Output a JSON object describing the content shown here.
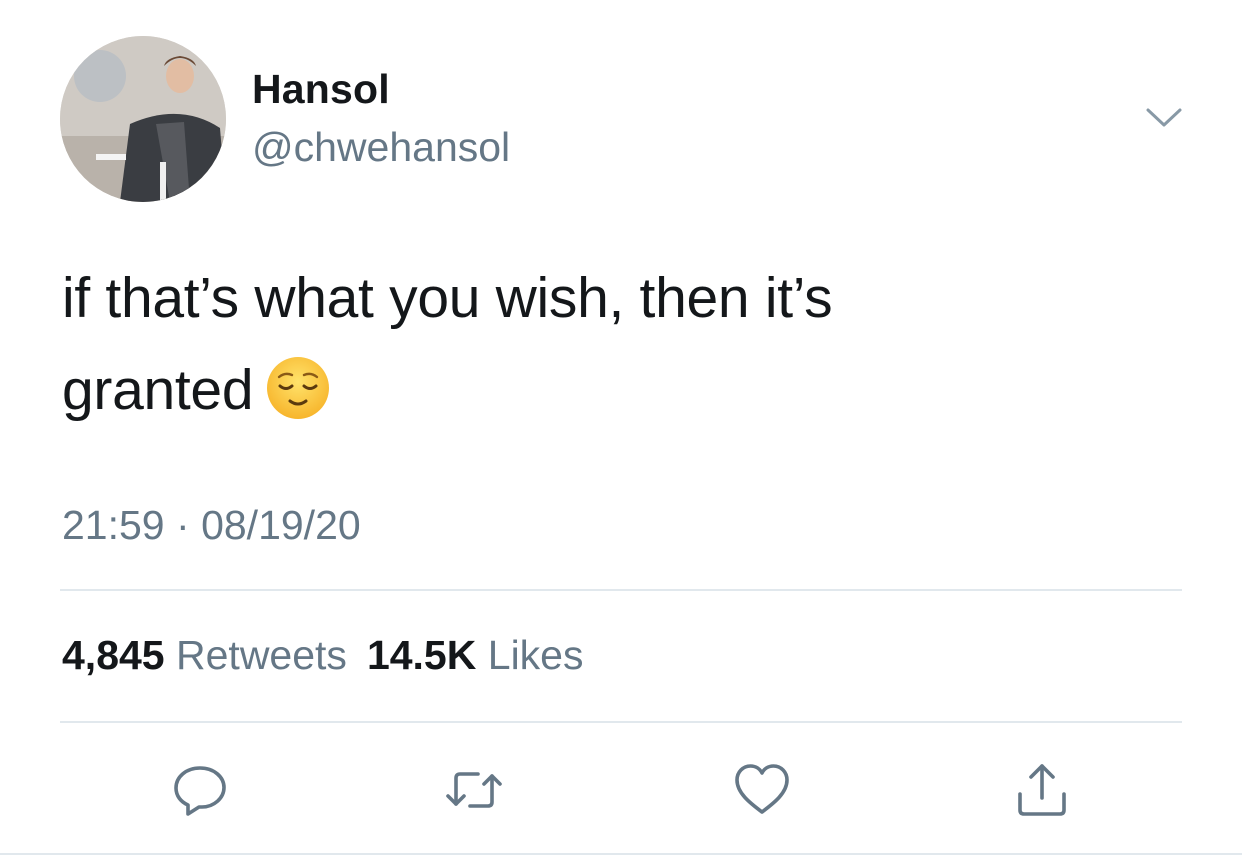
{
  "user": {
    "display_name": "Hansol",
    "handle": "@chwehansol",
    "avatar": "profile-photo"
  },
  "tweet": {
    "text_line1": "if that’s what you wish, then it’s",
    "text_line2": "granted",
    "emoji": "relieved-face",
    "time": "21:59",
    "separator": "·",
    "date": "08/19/20"
  },
  "stats": {
    "retweets_count": "4,845",
    "retweets_label": "Retweets",
    "likes_count": "14.5K",
    "likes_label": "Likes"
  },
  "actions": {
    "reply_icon": "reply-icon",
    "retweet_icon": "retweet-icon",
    "like_icon": "heart-icon",
    "share_icon": "share-icon"
  },
  "colors": {
    "text": "#14171a",
    "secondary": "#657786",
    "divider": "#e1e8ed",
    "background": "#ffffff"
  }
}
